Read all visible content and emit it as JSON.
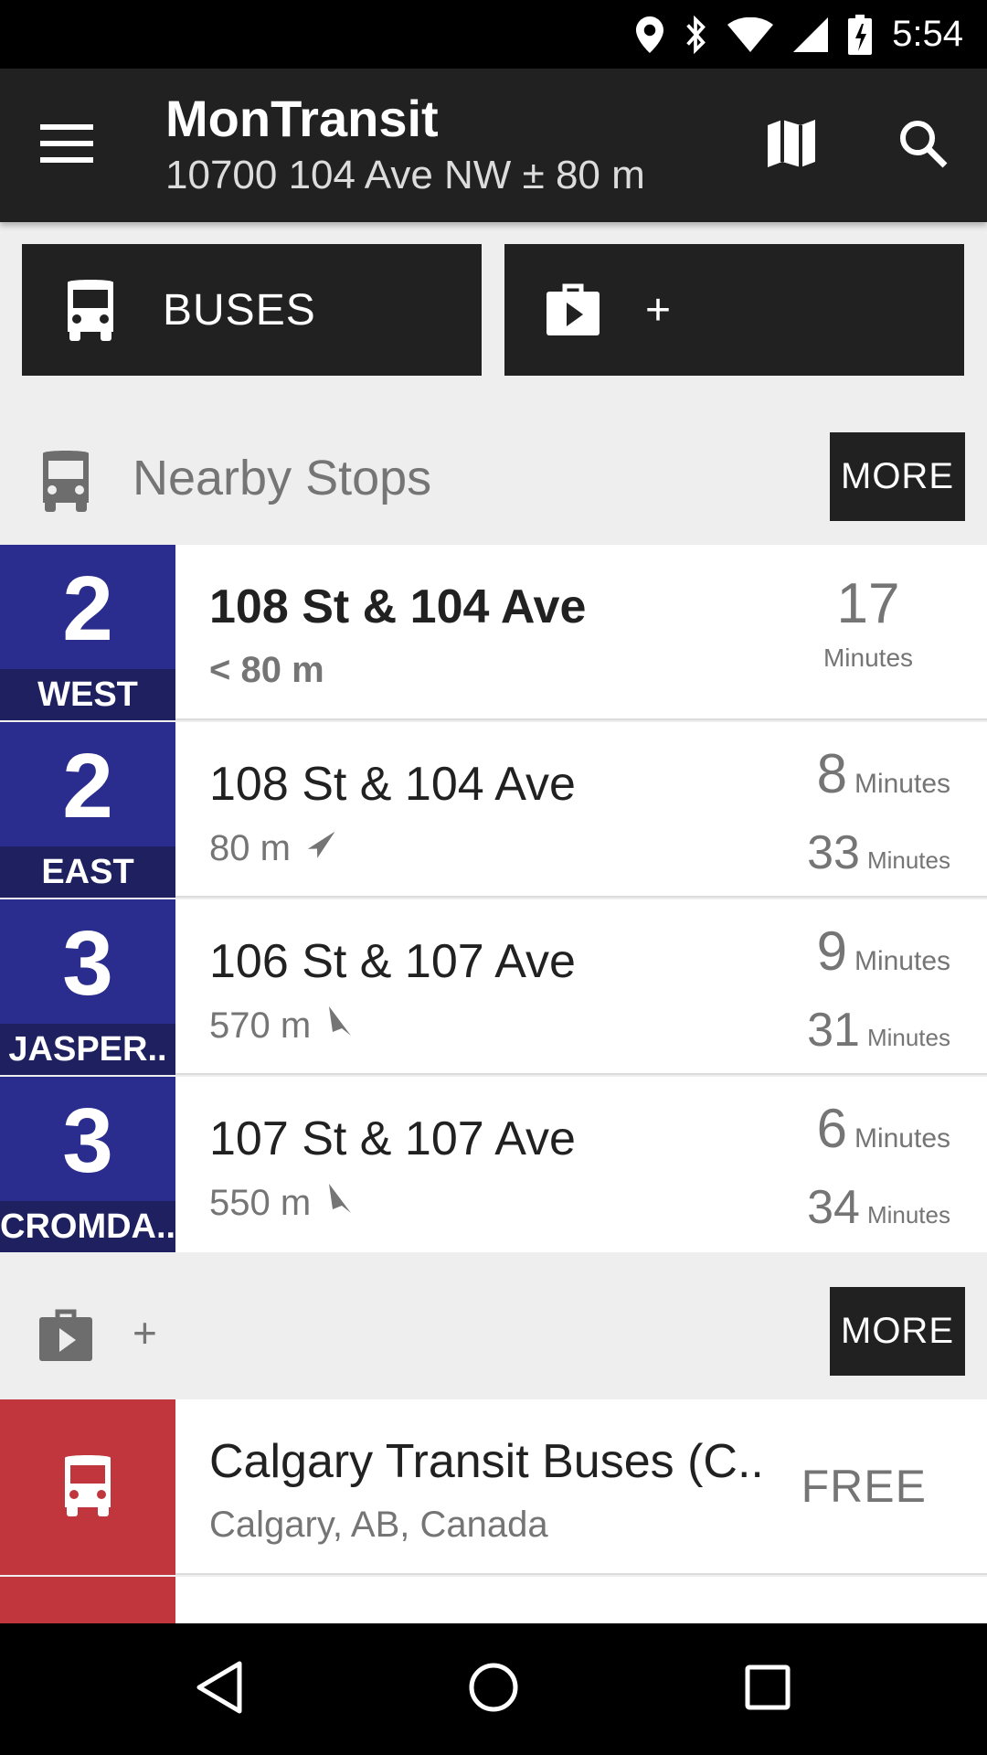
{
  "status_bar": {
    "time": "5:54"
  },
  "app_bar": {
    "title": "MonTransit",
    "subtitle": "10700 104 Ave NW ± 80 m",
    "icons": {
      "menu": "menu-icon",
      "map": "map-icon",
      "search": "search-icon"
    }
  },
  "type_tiles": [
    {
      "label": "BUSES",
      "icon": "bus-icon"
    },
    {
      "label": "+",
      "icon": "store-icon"
    }
  ],
  "nearby": {
    "title": "Nearby Stops",
    "more_label": "MORE",
    "rows": [
      {
        "route": "2",
        "direction": "WEST",
        "stop": "108 St & 104 Ave",
        "distance": "< 80 m",
        "times": [
          {
            "value": "17",
            "unit": "Minutes"
          }
        ]
      },
      {
        "route": "2",
        "direction": "EAST",
        "stop": "108 St & 104 Ave",
        "distance": "80 m",
        "times": [
          {
            "value": "8",
            "unit": "Minutes"
          },
          {
            "value": "33",
            "unit": "Minutes"
          }
        ]
      },
      {
        "route": "3",
        "direction": "JASPER..",
        "stop": "106 St & 107 Ave",
        "distance": "570 m",
        "times": [
          {
            "value": "9",
            "unit": "Minutes"
          },
          {
            "value": "31",
            "unit": "Minutes"
          }
        ]
      },
      {
        "route": "3",
        "direction": "CROMDA..",
        "stop": "107 St & 107 Ave",
        "distance": "550 m",
        "times": [
          {
            "value": "6",
            "unit": "Minutes"
          },
          {
            "value": "34",
            "unit": "Minutes"
          }
        ]
      }
    ]
  },
  "store_section": {
    "title": "+",
    "more_label": "MORE",
    "rows": [
      {
        "name": "Calgary Transit Buses (C..",
        "location": "Calgary, AB, Canada",
        "price": "FREE"
      }
    ]
  },
  "colors": {
    "route_bg": "#2a2d8e",
    "route_dir_bg": "#1e205f",
    "agency_bg": "#c1353d",
    "bar_bg": "#212121"
  }
}
